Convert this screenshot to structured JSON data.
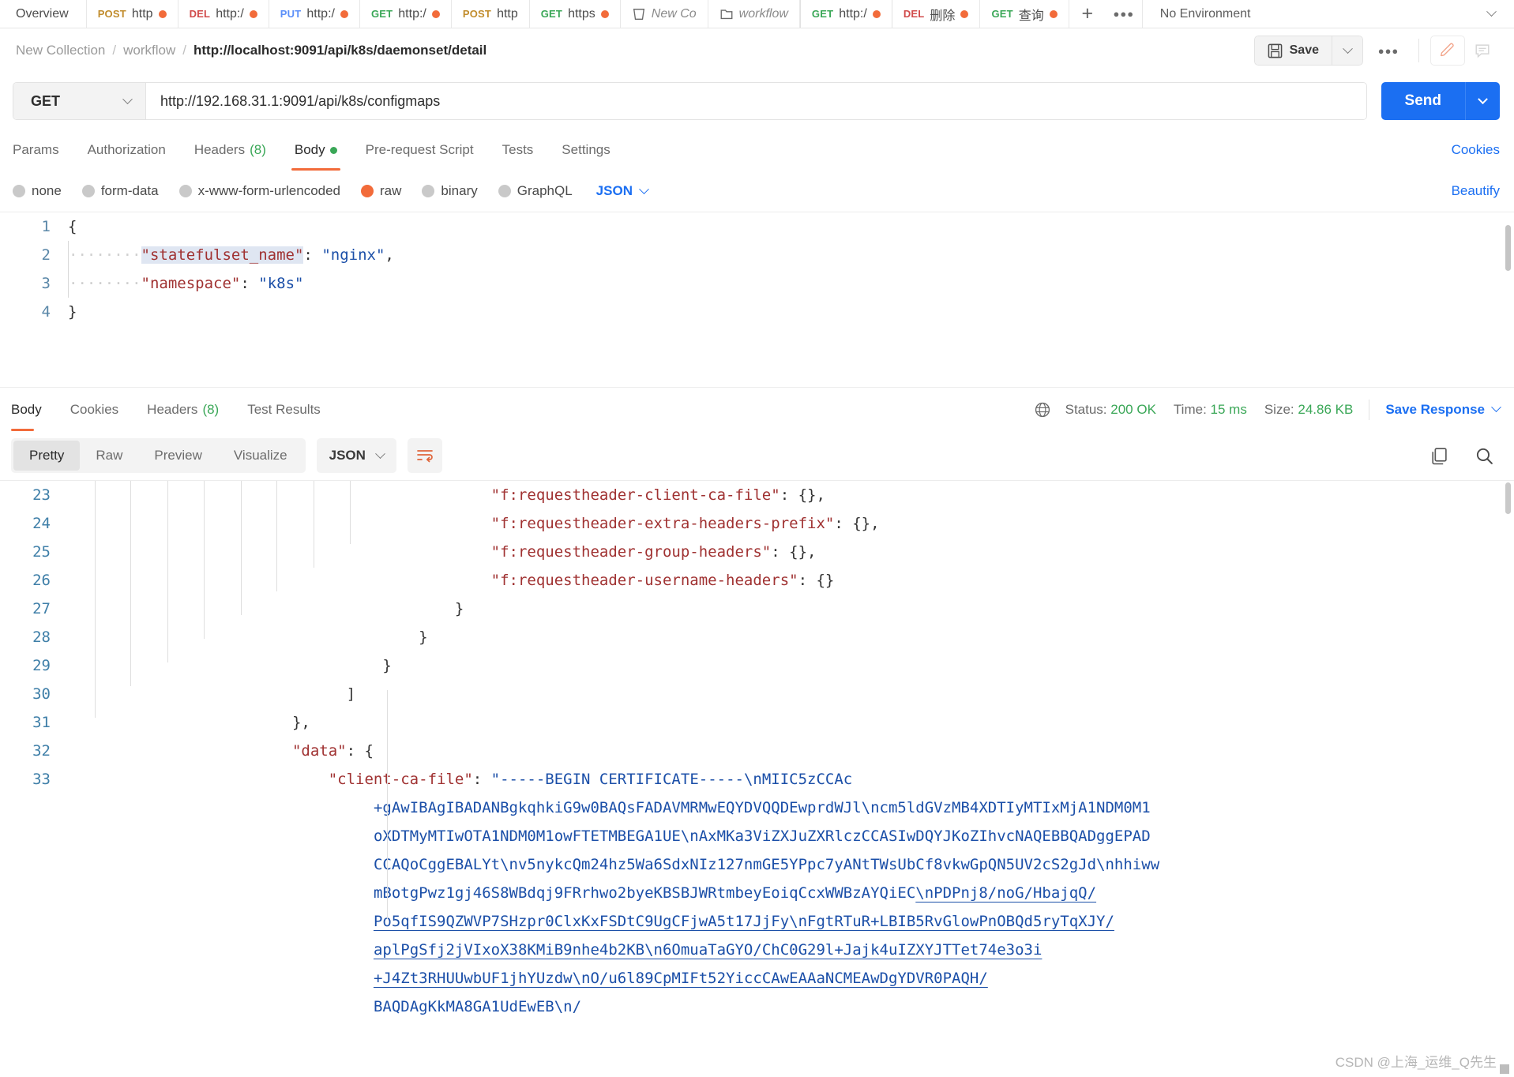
{
  "tabstrip": {
    "overview_label": "Overview",
    "tabs": [
      {
        "method": "POST",
        "method_class": "m-post",
        "label": "http",
        "dirty": true,
        "icon": null,
        "active": false
      },
      {
        "method": "DEL",
        "method_class": "m-del",
        "label": "http:/",
        "dirty": true,
        "icon": null,
        "active": false
      },
      {
        "method": "PUT",
        "method_class": "m-put",
        "label": "http:/",
        "dirty": true,
        "icon": null,
        "active": false
      },
      {
        "method": "GET",
        "method_class": "m-get",
        "label": "http:/",
        "dirty": true,
        "icon": null,
        "active": false
      },
      {
        "method": "POST",
        "method_class": "m-post",
        "label": "http",
        "dirty": false,
        "icon": null,
        "active": false
      },
      {
        "method": "GET",
        "method_class": "m-get",
        "label": "https",
        "dirty": true,
        "icon": null,
        "active": false
      },
      {
        "method": "",
        "method_class": "",
        "label": "New Co",
        "dirty": false,
        "icon": "collection-icon",
        "active": false
      },
      {
        "method": "",
        "method_class": "",
        "label": "workflow",
        "dirty": false,
        "icon": "folder-icon",
        "active": false
      },
      {
        "method": "GET",
        "method_class": "m-get",
        "label": "http:/",
        "dirty": true,
        "icon": null,
        "active": true
      },
      {
        "method": "DEL",
        "method_class": "m-del",
        "label": "删除",
        "dirty": true,
        "icon": null,
        "active": false
      },
      {
        "method": "GET",
        "method_class": "m-get",
        "label": "查询",
        "dirty": true,
        "icon": null,
        "active": false
      }
    ],
    "new_tab_label": "+",
    "more_label": "000",
    "environment": "No Environment"
  },
  "breadcrumb": {
    "items": [
      "New Collection",
      "workflow"
    ],
    "current": "http://localhost:9091/api/k8s/daemonset/detail",
    "separator": "/",
    "save_label": "Save",
    "more_label": "000"
  },
  "request": {
    "method": "GET",
    "url": "http://192.168.31.1:9091/api/k8s/configmaps",
    "send_label": "Send",
    "tabs": [
      {
        "label": "Params",
        "count": null,
        "dot": false,
        "active": false
      },
      {
        "label": "Authorization",
        "count": null,
        "dot": false,
        "active": false
      },
      {
        "label": "Headers",
        "count": "(8)",
        "dot": false,
        "active": false
      },
      {
        "label": "Body",
        "count": null,
        "dot": true,
        "active": true
      },
      {
        "label": "Pre-request Script",
        "count": null,
        "dot": false,
        "active": false
      },
      {
        "label": "Tests",
        "count": null,
        "dot": false,
        "active": false
      },
      {
        "label": "Settings",
        "count": null,
        "dot": false,
        "active": false
      }
    ],
    "cookies_label": "Cookies",
    "body_types": [
      {
        "label": "none",
        "selected": false
      },
      {
        "label": "form-data",
        "selected": false
      },
      {
        "label": "x-www-form-urlencoded",
        "selected": false
      },
      {
        "label": "raw",
        "selected": true
      },
      {
        "label": "binary",
        "selected": false
      },
      {
        "label": "GraphQL",
        "selected": false
      }
    ],
    "format": "JSON",
    "beautify_label": "Beautify",
    "body_lines": [
      {
        "n": "1",
        "indent": 0,
        "parts": [
          {
            "t": "{",
            "c": "p"
          }
        ]
      },
      {
        "n": "2",
        "indent": 1,
        "parts": [
          {
            "t": "\"statefulset_name\"",
            "c": "k",
            "hl": true
          },
          {
            "t": ":",
            "c": "p"
          },
          {
            "t": " ",
            "c": "dots"
          },
          {
            "t": "\"nginx\"",
            "c": "s"
          },
          {
            "t": ",",
            "c": "p"
          }
        ]
      },
      {
        "n": "3",
        "indent": 1,
        "parts": [
          {
            "t": "\"namespace\"",
            "c": "k"
          },
          {
            "t": ":",
            "c": "p"
          },
          {
            "t": " ",
            "c": "dots"
          },
          {
            "t": "\"k8s\"",
            "c": "s"
          }
        ]
      },
      {
        "n": "4",
        "indent": 0,
        "parts": [
          {
            "t": "}",
            "c": "p"
          }
        ]
      }
    ]
  },
  "response": {
    "tabs": [
      {
        "label": "Body",
        "count": null,
        "active": true
      },
      {
        "label": "Cookies",
        "count": null,
        "active": false
      },
      {
        "label": "Headers",
        "count": "(8)",
        "active": false
      },
      {
        "label": "Test Results",
        "count": null,
        "active": false
      }
    ],
    "status_label": "Status:",
    "status_value": "200 OK",
    "time_label": "Time:",
    "time_value": "15 ms",
    "size_label": "Size:",
    "size_value": "24.86 KB",
    "save_response_label": "Save Response",
    "view_modes": [
      {
        "label": "Pretty",
        "active": true
      },
      {
        "label": "Raw",
        "active": false
      },
      {
        "label": "Preview",
        "active": false
      },
      {
        "label": "Visualize",
        "active": false
      }
    ],
    "format": "JSON",
    "lines": [
      {
        "n": "23",
        "pad": 47,
        "parts": [
          {
            "t": "\"f:requestheader-client-ca-file\"",
            "c": "k"
          },
          {
            "t": ": {},",
            "c": "p"
          }
        ]
      },
      {
        "n": "24",
        "pad": 47,
        "parts": [
          {
            "t": "\"f:requestheader-extra-headers-prefix\"",
            "c": "k"
          },
          {
            "t": ": {},",
            "c": "p"
          }
        ]
      },
      {
        "n": "25",
        "pad": 47,
        "parts": [
          {
            "t": "\"f:requestheader-group-headers\"",
            "c": "k"
          },
          {
            "t": ": {},",
            "c": "p"
          }
        ]
      },
      {
        "n": "26",
        "pad": 47,
        "parts": [
          {
            "t": "\"f:requestheader-username-headers\"",
            "c": "k"
          },
          {
            "t": ": {}",
            "c": "p"
          }
        ]
      },
      {
        "n": "27",
        "pad": 43,
        "parts": [
          {
            "t": "}",
            "c": "p"
          }
        ]
      },
      {
        "n": "28",
        "pad": 39,
        "parts": [
          {
            "t": "}",
            "c": "p"
          }
        ]
      },
      {
        "n": "29",
        "pad": 35,
        "parts": [
          {
            "t": "}",
            "c": "p"
          }
        ]
      },
      {
        "n": "30",
        "pad": 31,
        "parts": [
          {
            "t": "]",
            "c": "p"
          }
        ]
      },
      {
        "n": "31",
        "pad": 25,
        "parts": [
          {
            "t": "},",
            "c": "p"
          }
        ]
      },
      {
        "n": "32",
        "pad": 25,
        "parts": [
          {
            "t": "\"data\"",
            "c": "k"
          },
          {
            "t": ": {",
            "c": "p"
          }
        ]
      },
      {
        "n": "33",
        "pad": 29,
        "parts": [
          {
            "t": "\"client-ca-file\"",
            "c": "k"
          },
          {
            "t": ": ",
            "c": "p"
          },
          {
            "t": "\"-----BEGIN CERTIFICATE-----\\nMIIC5zCCAc",
            "c": "s"
          }
        ]
      },
      {
        "n": "",
        "pad": 34,
        "parts": [
          {
            "t": "+gAwIBAgIBADANBgkqhkiG9w0BAQsFADAVMRMwEQYDVQQDEwprdWJl\\ncm5ldGVzMB4XDTIyMTIxMjA1NDM0M1",
            "c": "s"
          }
        ]
      },
      {
        "n": "",
        "pad": 34,
        "parts": [
          {
            "t": "oXDTMyMTIwOTA1NDM0M1owFTETMBEGA1UE\\nAxMKa3ViZXJuZXRlczCCASIwDQYJKoZIhvcNAQEBBQADggEPAD",
            "c": "s"
          }
        ]
      },
      {
        "n": "",
        "pad": 34,
        "parts": [
          {
            "t": "CCAQoCggEBALYt\\nv5nykcQm24hz5Wa6SdxNIz127nmGE5YPpc7yANtTWsUbCf8vkwGpQN5UV2cS2gJd\\nhhiww",
            "c": "s"
          }
        ]
      },
      {
        "n": "",
        "pad": 34,
        "parts": [
          {
            "t": "mBotgPwz1gj46S8WBdqj9FRrhwo2byeKBSBJWRtmbeyEoiqCcxWWBzAYQiEC",
            "c": "s"
          },
          {
            "t": "\\nPDPnj8/noG/HbajqQ/",
            "c": "s",
            "ul": true
          }
        ]
      },
      {
        "n": "",
        "pad": 34,
        "parts": [
          {
            "t": "Po5qfIS9QZWVP7SHzpr0ClxKxFSDtC9UgCFjwA5t17JjFy\\nFgtRTuR+LBIB5RvGlowPnOBQd5ryTqXJY/",
            "c": "s",
            "ul": true
          }
        ]
      },
      {
        "n": "",
        "pad": 34,
        "parts": [
          {
            "t": "aplPgSfj2jVIxoX38KMiB9nhe4b2KB\\n6OmuaTaGYO/ChC0G29l+Jajk4uIZXYJTTet74e3o3i",
            "c": "s",
            "ul": true
          }
        ]
      },
      {
        "n": "",
        "pad": 34,
        "parts": [
          {
            "t": "+J4Zt3RHUUwbUF1jhYUzdw\\nO/u6l89CpMIFt52YiccCAwEAAaNCMEAwDgYDVR0PAQH/",
            "c": "s",
            "ul": true
          }
        ]
      },
      {
        "n": "",
        "pad": 34,
        "parts": [
          {
            "t": "BAQDAgKkMA8GA1UdEwEB\\n/",
            "c": "s"
          }
        ]
      }
    ],
    "watermark": "CSDN @上海_运维_Q先生"
  }
}
